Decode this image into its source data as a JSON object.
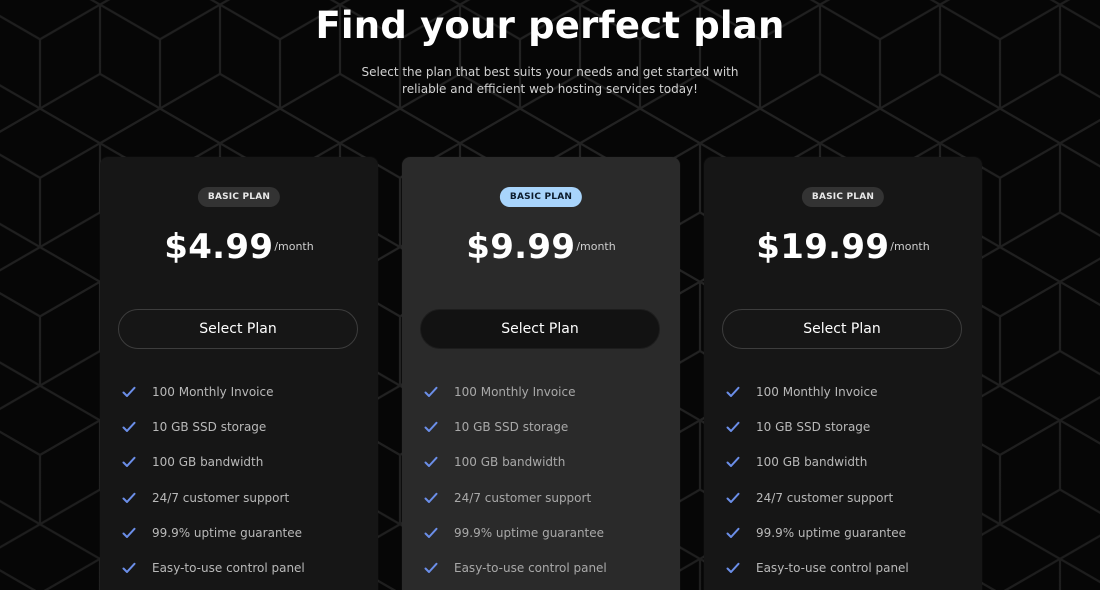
{
  "header": {
    "title": "Find your perfect plan",
    "subtitle": "Select the plan that best suits your needs and get started with reliable and efficient web hosting services today!"
  },
  "colors": {
    "background": "#060606",
    "card": "#161616",
    "card_featured": "#2a2a2a",
    "badge": "#333333",
    "badge_featured": "#a8d4fb",
    "check": "#6b8ee8"
  },
  "plans": [
    {
      "badge": "BASIC PLAN",
      "price": "$4.99",
      "period": "/month",
      "button_label": "Select Plan",
      "featured": false,
      "features": [
        "100 Monthly Invoice",
        "10 GB SSD storage",
        "100 GB bandwidth",
        "24/7 customer support",
        "99.9% uptime guarantee",
        "Easy-to-use control panel"
      ]
    },
    {
      "badge": "BASIC PLAN",
      "price": "$9.99",
      "period": "/month",
      "button_label": "Select Plan",
      "featured": true,
      "features": [
        "100 Monthly Invoice",
        "10 GB SSD storage",
        "100 GB bandwidth",
        "24/7 customer support",
        "99.9% uptime guarantee",
        "Easy-to-use control panel"
      ]
    },
    {
      "badge": "BASIC PLAN",
      "price": "$19.99",
      "period": "/month",
      "button_label": "Select Plan",
      "featured": false,
      "features": [
        "100 Monthly Invoice",
        "10 GB SSD storage",
        "100 GB bandwidth",
        "24/7 customer support",
        "99.9% uptime guarantee",
        "Easy-to-use control panel"
      ]
    }
  ]
}
